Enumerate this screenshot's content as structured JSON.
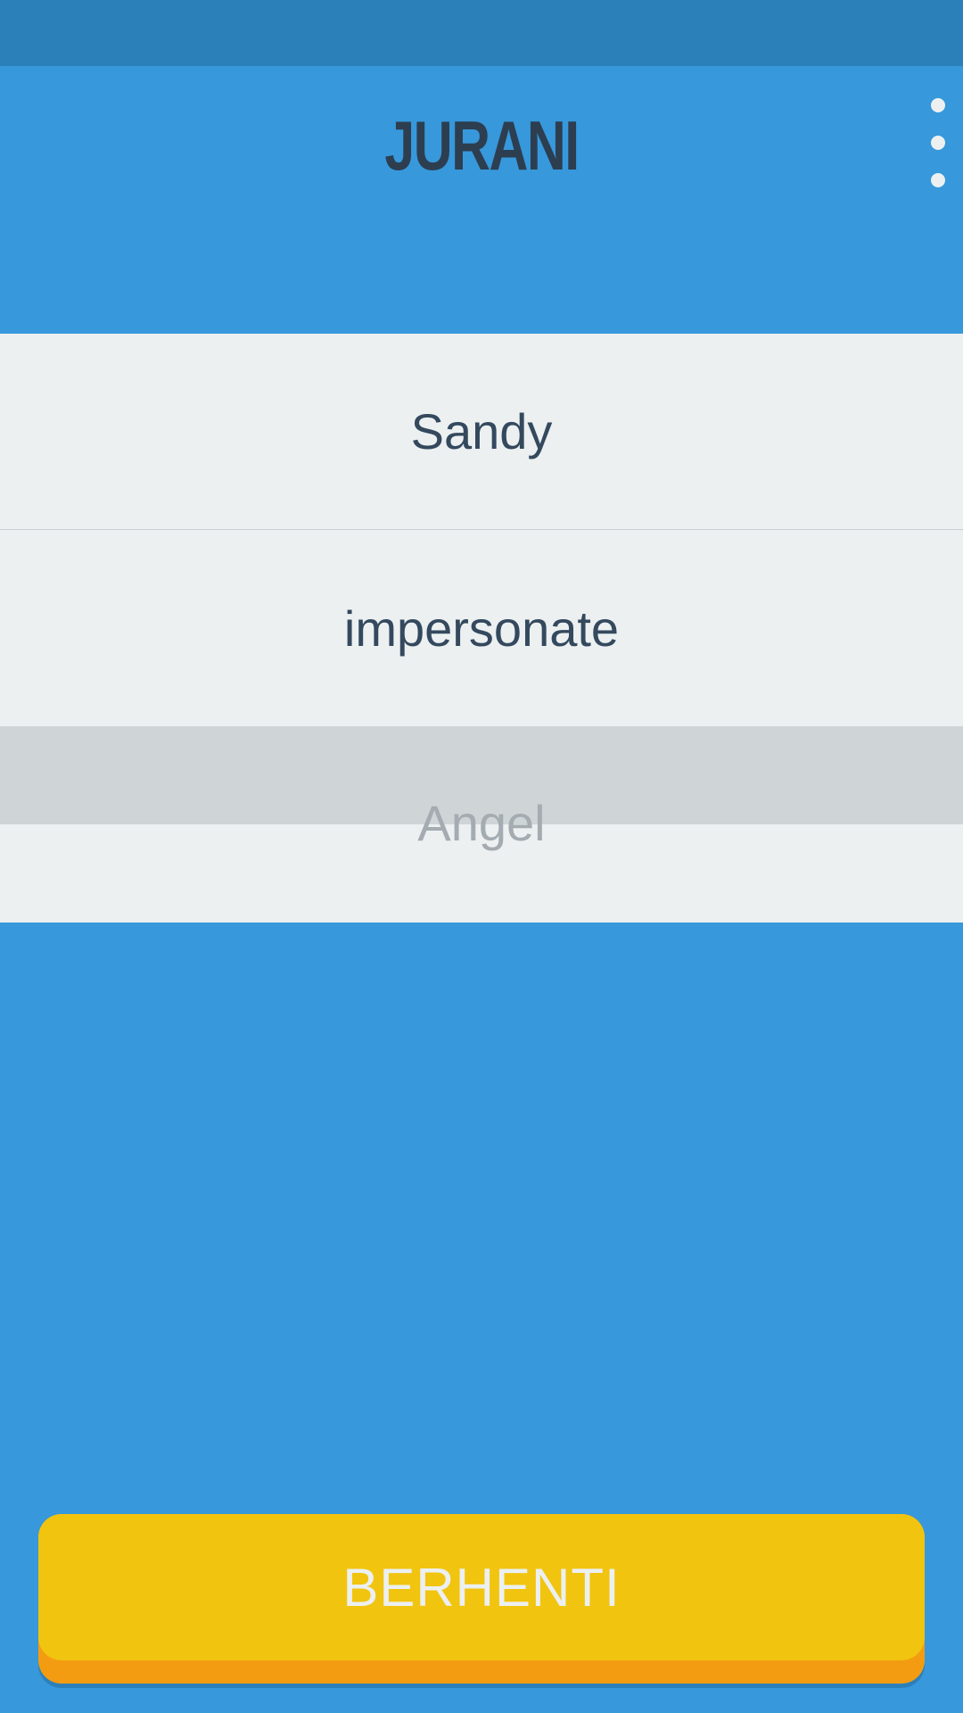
{
  "app": {
    "title": "JURANI",
    "menu_icon": "more-vert-icon"
  },
  "word_list": {
    "items": [
      {
        "label": "Sandy"
      },
      {
        "label": "impersonate"
      },
      {
        "label": "Angel"
      }
    ]
  },
  "stop_button": {
    "label": "BERHENTI"
  },
  "colors": {
    "background": "#3798db",
    "status_bar": "#2c80ba",
    "title_text": "#2c3e50",
    "list_background": "#ecf0f1",
    "list_text": "#34495e",
    "active_band": "#cfd4d7",
    "active_text": "#a4abb1",
    "button_face": "#f1c40f",
    "button_shadow": "#f39c12",
    "button_text": "#ecf0f1"
  }
}
